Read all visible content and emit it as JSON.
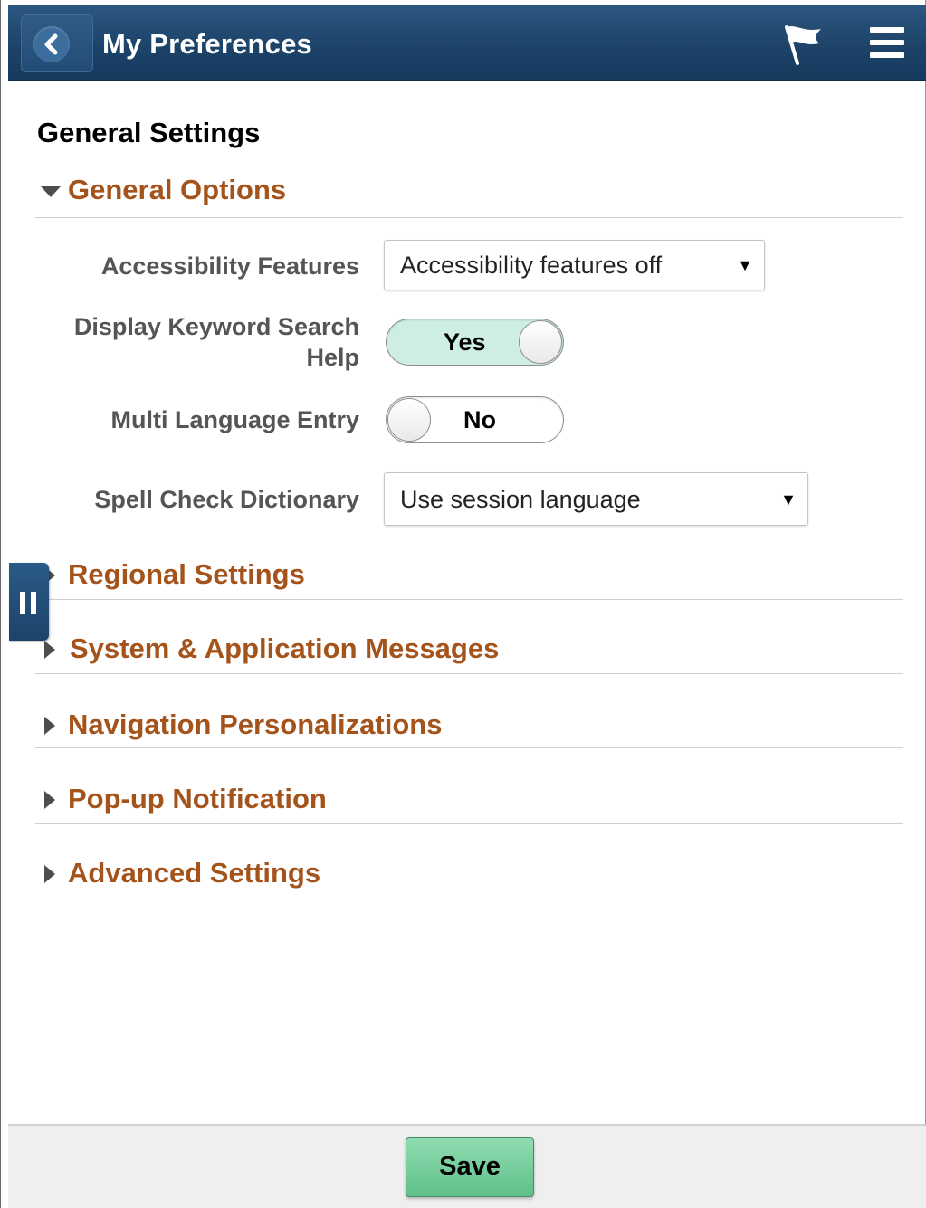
{
  "header": {
    "title": "My Preferences",
    "back_icon": "chevron-left-icon",
    "flag_icon": "flag-icon",
    "menu_icon": "hamburger-menu-icon"
  },
  "page": {
    "section_title": "General Settings"
  },
  "general_options": {
    "label": "General Options",
    "expanded": true,
    "fields": {
      "accessibility": {
        "label": "Accessibility Features",
        "value": "Accessibility features off"
      },
      "keyword_help": {
        "label_line1": "Display Keyword Search",
        "label_line2": "Help",
        "value": "Yes",
        "state": true
      },
      "multi_language": {
        "label": "Multi Language Entry",
        "value": "No",
        "state": false
      },
      "spell_check": {
        "label": "Spell Check Dictionary",
        "value": "Use session language"
      }
    }
  },
  "groups": [
    {
      "label": "Regional Settings",
      "expanded": false
    },
    {
      "label": "System & Application Messages",
      "expanded": false
    },
    {
      "label": "Navigation Personalizations",
      "expanded": false
    },
    {
      "label": "Pop-up Notification",
      "expanded": false
    },
    {
      "label": "Advanced Settings",
      "expanded": false
    }
  ],
  "footer": {
    "save_label": "Save"
  },
  "colors": {
    "header": "#1d4369",
    "group_label": "#a4531b",
    "toggle_on": "#cdeee0",
    "save_button": "#6fcb97"
  }
}
